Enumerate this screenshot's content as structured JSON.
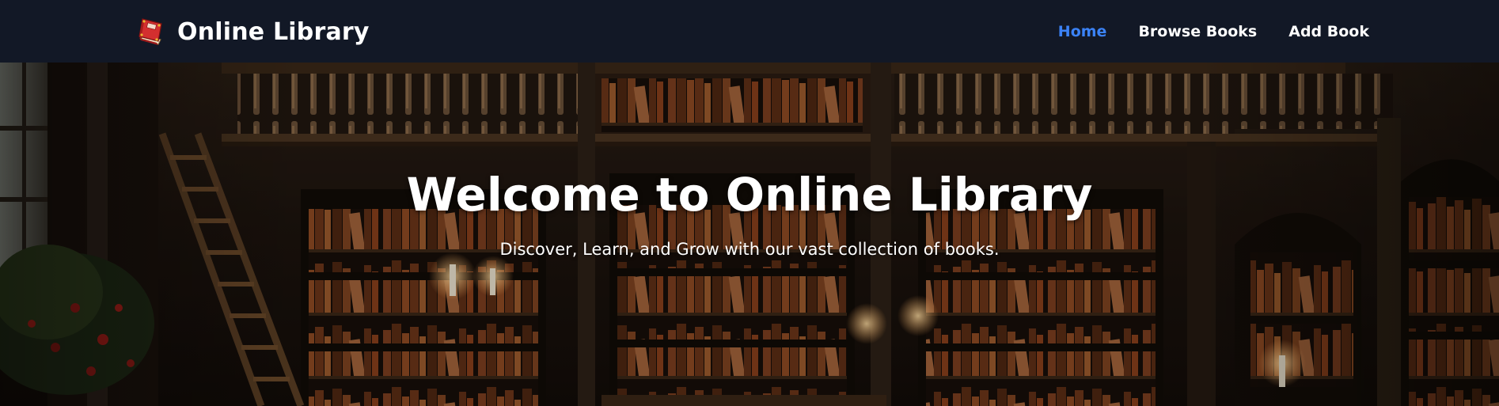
{
  "brand": {
    "icon": "red-book-icon",
    "title": "Online Library"
  },
  "nav": {
    "items": [
      {
        "label": "Home",
        "active": true
      },
      {
        "label": "Browse Books",
        "active": false
      },
      {
        "label": "Add Book",
        "active": false
      }
    ]
  },
  "hero": {
    "background": "library-interior-image",
    "title": "Welcome to Online Library",
    "subtitle": "Discover, Learn, and Grow with our vast collection of books."
  },
  "colors": {
    "navbar_bg": "#121826",
    "active_link": "#3b82f6",
    "text": "#ffffff"
  }
}
